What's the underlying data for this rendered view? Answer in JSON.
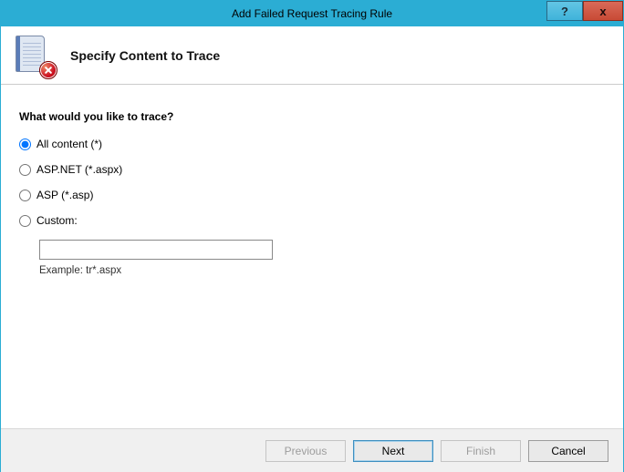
{
  "window": {
    "title": "Add Failed Request Tracing Rule"
  },
  "header": {
    "title": "Specify Content to Trace"
  },
  "form": {
    "prompt": "What would you like to trace?",
    "options": {
      "all": "All content (*)",
      "aspnet": "ASP.NET (*.aspx)",
      "asp": "ASP (*.asp)",
      "custom": "Custom:"
    },
    "custom_value": "",
    "example": "Example: tr*.aspx",
    "selected": "all"
  },
  "footer": {
    "previous": "Previous",
    "next": "Next",
    "finish": "Finish",
    "cancel": "Cancel"
  }
}
